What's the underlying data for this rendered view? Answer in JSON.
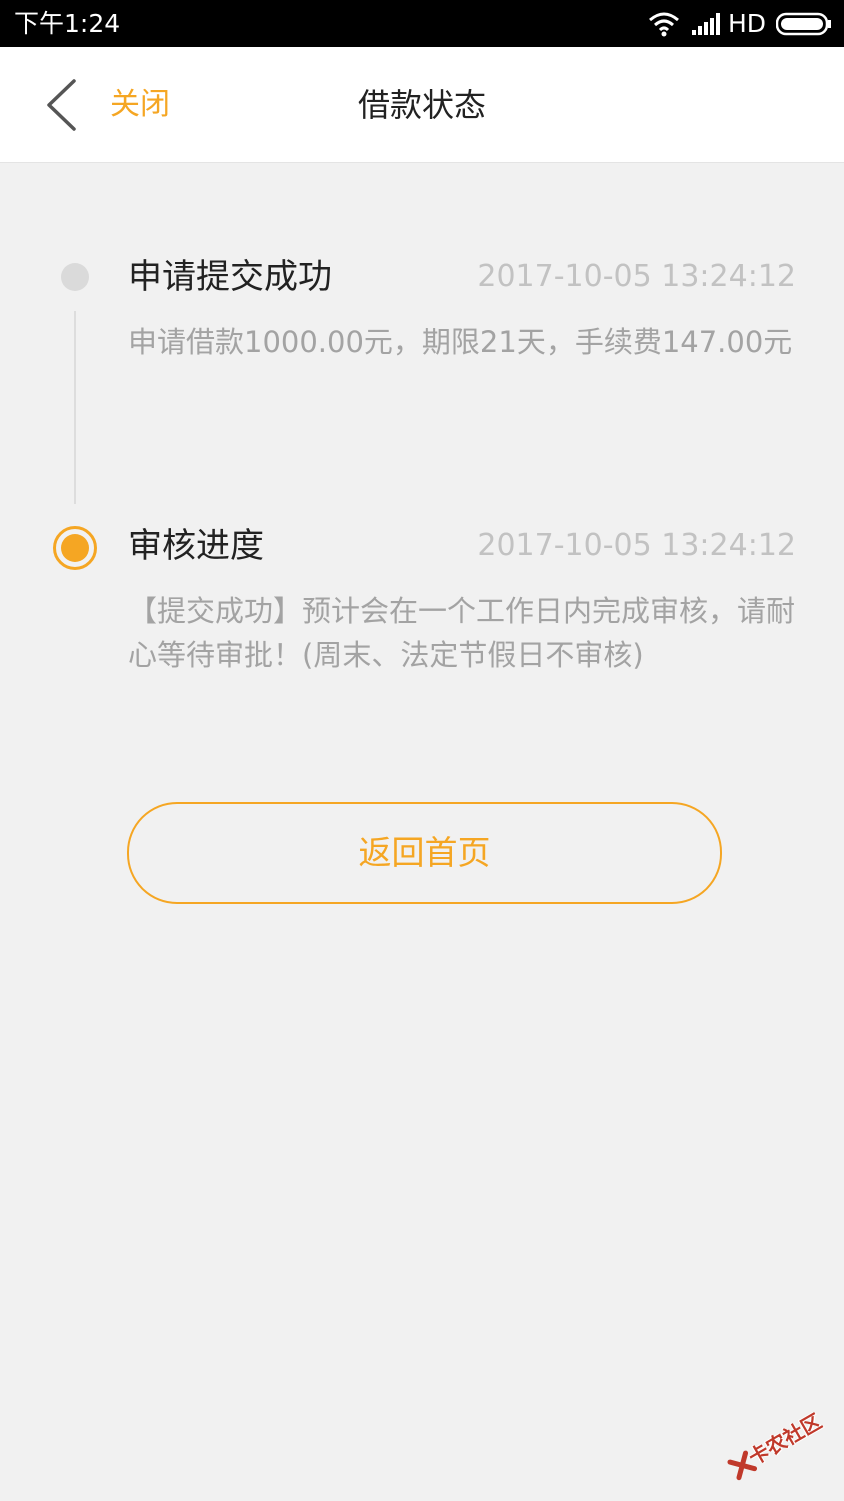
{
  "status_bar": {
    "time": "下午1:24",
    "network": "HD",
    "icons": [
      "wifi-icon",
      "signal-icon",
      "battery-icon"
    ]
  },
  "nav": {
    "back_icon": "chevron-left-icon",
    "close_label": "关闭",
    "title": "借款状态"
  },
  "timeline": {
    "steps": [
      {
        "title": "申请提交成功",
        "time": "2017-10-05 13:24:12",
        "desc": "申请借款1000.00元，期限21天，手续费147.00元",
        "state": "done"
      },
      {
        "title": "审核进度",
        "time": "2017-10-05 13:24:12",
        "desc": "【提交成功】预计会在一个工作日内完成审核，请耐心等待审批！(周末、法定节假日不审核)",
        "state": "active"
      }
    ]
  },
  "actions": {
    "home_label": "返回首页"
  },
  "watermark": {
    "text": "卡农社区",
    "icon": "kanong-logo-icon"
  },
  "colors": {
    "accent": "#f5a623",
    "background": "#f1f1f1",
    "muted_text": "#a3a3a3"
  }
}
